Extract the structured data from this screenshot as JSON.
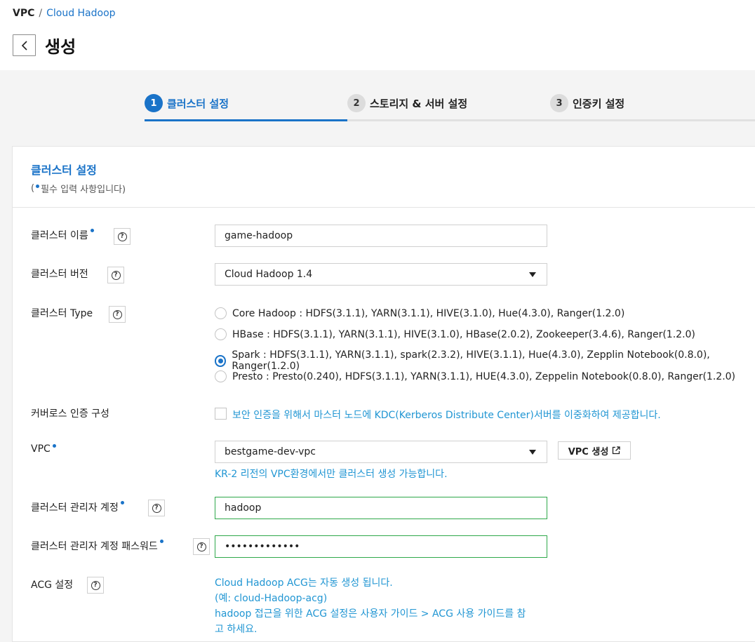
{
  "breadcrumb": {
    "root": "VPC",
    "separator": "/",
    "current": "Cloud Hadoop"
  },
  "page": {
    "title": "생성"
  },
  "steps": [
    {
      "num": "1",
      "label": "클러스터 설정",
      "active": true
    },
    {
      "num": "2",
      "label": "스토리지 & 서버 설정",
      "active": false
    },
    {
      "num": "3",
      "label": "인증키 설정",
      "active": false
    }
  ],
  "card": {
    "title": "클러스터 설정",
    "required_open": "(",
    "required_note": "필수 입력 사항입니다)"
  },
  "form": {
    "cluster_name": {
      "label": "클러스터 이름",
      "value": "game-hadoop"
    },
    "cluster_version": {
      "label": "클러스터 버전",
      "value": "Cloud Hadoop 1.4"
    },
    "cluster_type": {
      "label": "클러스터 Type",
      "options": [
        "Core Hadoop : HDFS(3.1.1), YARN(3.1.1), HIVE(3.1.0), Hue(4.3.0), Ranger(1.2.0)",
        "HBase : HDFS(3.1.1), YARN(3.1.1), HIVE(3.1.0), HBase(2.0.2), Zookeeper(3.4.6), Ranger(1.2.0)",
        "Spark : HDFS(3.1.1), YARN(3.1.1), spark(2.3.2), HIVE(3.1.1), Hue(4.3.0), Zepplin Notebook(0.8.0), Ranger(1.2.0)",
        "Presto : Presto(0.240), HDFS(3.1.1), YARN(3.1.1), HUE(4.3.0), Zeppelin Notebook(0.8.0), Ranger(1.2.0)"
      ],
      "selected_index": 2
    },
    "kerberos": {
      "label": "커버로스 인증 구성",
      "text": "보안 인증을 위해서 마스터 노드에 KDC(Kerberos Distribute Center)서버를 이중화하여 제공합니다."
    },
    "vpc": {
      "label": "VPC",
      "value": "bestgame-dev-vpc",
      "create_button": "VPC 생성",
      "hint": "KR-2 리전의 VPC환경에서만 클러스터 생성 가능합니다."
    },
    "admin_account": {
      "label": "클러스터 관리자 계정",
      "value": "hadoop"
    },
    "admin_password": {
      "label": "클러스터 관리자 계정 패스워드",
      "value": "•••••••••••••"
    },
    "acg": {
      "label": "ACG 설정",
      "lines": [
        "Cloud Hadoop ACG는 자동 생성 됩니다.",
        "(예: cloud-Hadoop-acg)",
        "hadoop 접근을 위한 ACG 설정은 사용자 가이드 > ACG 사용 가이드를 참",
        "고 하세요."
      ]
    },
    "help_icon_text": "?"
  },
  "colors": {
    "accent": "#1a73c8",
    "hint": "#2196d3",
    "valid": "#2ea84a"
  }
}
